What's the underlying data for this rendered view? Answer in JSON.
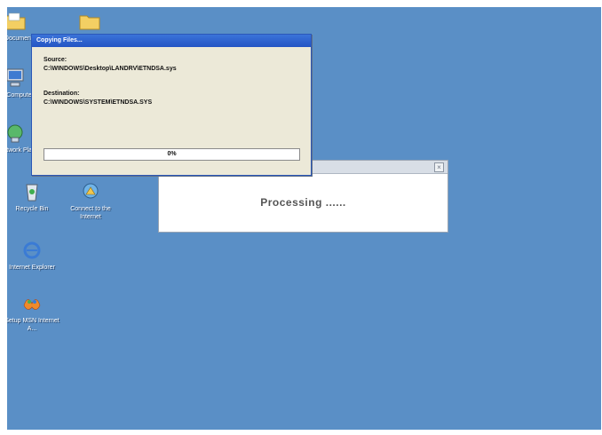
{
  "desktop": {
    "icons": [
      {
        "label": "My Documents",
        "icon": "folder-icon"
      },
      {
        "label": "",
        "icon": "folder-icon"
      },
      {
        "label": "My Computer",
        "icon": "computer-icon"
      },
      {
        "label": "My Network Places",
        "icon": "network-icon"
      },
      {
        "label": "Recycle Bin",
        "icon": "recycle-bin-icon"
      },
      {
        "label": "Connect to the Internet",
        "icon": "connect-icon"
      },
      {
        "label": "Internet Explorer",
        "icon": "internet-explorer-icon"
      },
      {
        "label": "Setup MSN Internet A...",
        "icon": "msn-icon"
      }
    ],
    "background_color": "#5a8fc6"
  },
  "copy_dialog": {
    "title": "Copying Files...",
    "source_label": "Source:",
    "source_path": "C:\\WINDOWS\\Desktop\\LANDRV\\ETNDSA.sys",
    "dest_label": "Destination:",
    "dest_path": "C:\\WINDOWS\\SYSTEM\\ETNDSA.SYS",
    "progress_text": "0%",
    "progress_fraction": 0
  },
  "processing_window": {
    "text": "Processing ......",
    "close_icon": "close-icon"
  }
}
